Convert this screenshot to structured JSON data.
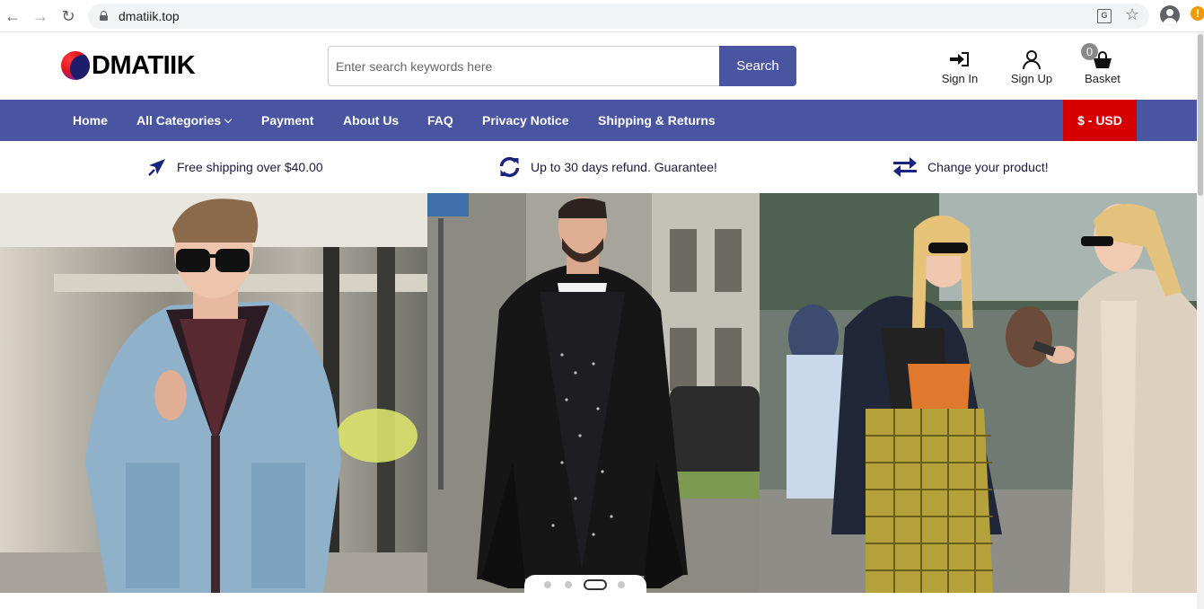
{
  "browser": {
    "url": "dmatiik.top"
  },
  "header": {
    "logo_text": "DMATIIK",
    "search_placeholder": "Enter search keywords here",
    "search_button": "Search",
    "sign_in": "Sign In",
    "sign_up": "Sign Up",
    "basket": "Basket",
    "basket_count": "0"
  },
  "nav": {
    "items": [
      "Home",
      "All Categories",
      "Payment",
      "About Us",
      "FAQ",
      "Privacy Notice",
      "Shipping & Returns"
    ],
    "currency": "$ - USD"
  },
  "features": [
    {
      "icon": "airplane-icon",
      "text": "Free shipping over $40.00"
    },
    {
      "icon": "refresh-icon",
      "text": "Up to 30 days refund. Guarantee!"
    },
    {
      "icon": "exchange-icon",
      "text": "Change your product!"
    }
  ],
  "hero": {
    "slide_count": 4,
    "active_slide": 3
  },
  "colors": {
    "brand": "#4a55a2",
    "currency": "#d60000"
  }
}
